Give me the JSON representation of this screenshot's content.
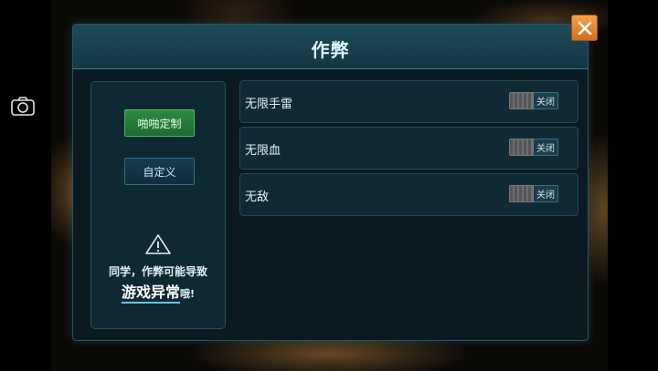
{
  "dialog": {
    "title": "作弊",
    "close_icon": "close-icon"
  },
  "sidebar": {
    "preset_button": "啪啪定制",
    "custom_button": "自定义",
    "warning": {
      "icon": "warning-icon",
      "line1": "同学，作弊可能导致",
      "line2_emphasis": "游戏异常",
      "line2_suffix": "哦!"
    }
  },
  "cheats": [
    {
      "label": "无限手雷",
      "toggle_state": "关闭"
    },
    {
      "label": "无限血",
      "toggle_state": "关闭"
    },
    {
      "label": "无敌",
      "toggle_state": "关闭"
    }
  ],
  "overlay": {
    "camera_icon": "camera-icon"
  },
  "colors": {
    "accent": "#5cc7e6",
    "preset_button": "#2d8a44",
    "close_button": "#e8892f",
    "panel": "#0b1a21"
  }
}
